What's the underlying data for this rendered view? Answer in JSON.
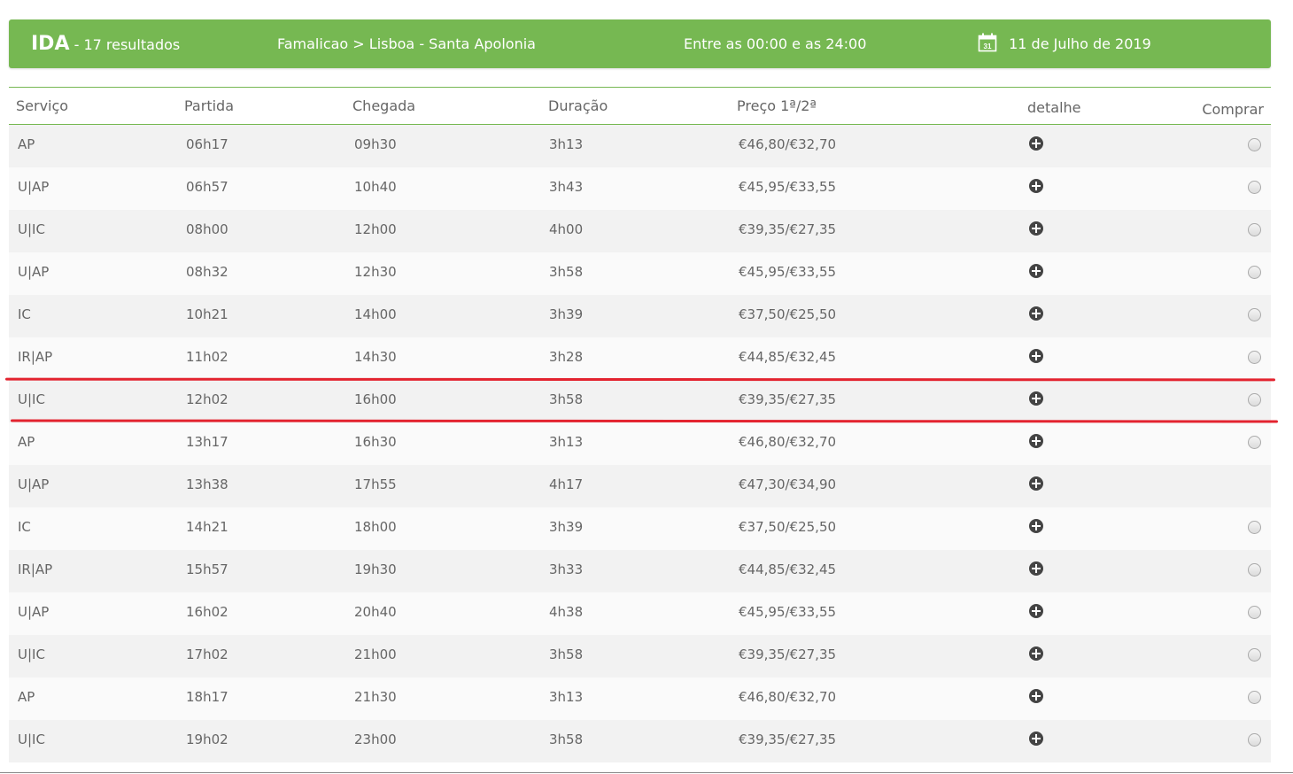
{
  "header": {
    "direction": "IDA",
    "results": "- 17 resultados",
    "route": "Famalicao > Lisboa - Santa Apolonia",
    "time_range": "Entre as 00:00 e as 24:00",
    "date": "11 de Julho de 2019",
    "calendar_day": "31",
    "accent_color": "#76b852"
  },
  "table": {
    "columns": [
      "Serviço",
      "Partida",
      "Chegada",
      "Duração",
      "Preço 1ª/2ª",
      "detalhe",
      "Comprar"
    ],
    "rows": [
      {
        "servico": "AP",
        "partida": "06h17",
        "chegada": "09h30",
        "duracao": "3h13",
        "preco": "€46,80/€32,70",
        "buy": true
      },
      {
        "servico": "U|AP",
        "partida": "06h57",
        "chegada": "10h40",
        "duracao": "3h43",
        "preco": "€45,95/€33,55",
        "buy": true
      },
      {
        "servico": "U|IC",
        "partida": "08h00",
        "chegada": "12h00",
        "duracao": "4h00",
        "preco": "€39,35/€27,35",
        "buy": true
      },
      {
        "servico": "U|AP",
        "partida": "08h32",
        "chegada": "12h30",
        "duracao": "3h58",
        "preco": "€45,95/€33,55",
        "buy": true
      },
      {
        "servico": "IC",
        "partida": "10h21",
        "chegada": "14h00",
        "duracao": "3h39",
        "preco": "€37,50/€25,50",
        "buy": true
      },
      {
        "servico": "IR|AP",
        "partida": "11h02",
        "chegada": "14h30",
        "duracao": "3h28",
        "preco": "€44,85/€32,45",
        "buy": true
      },
      {
        "servico": "U|IC",
        "partida": "12h02",
        "chegada": "16h00",
        "duracao": "3h58",
        "preco": "€39,35/€27,35",
        "buy": true
      },
      {
        "servico": "AP",
        "partida": "13h17",
        "chegada": "16h30",
        "duracao": "3h13",
        "preco": "€46,80/€32,70",
        "buy": true
      },
      {
        "servico": "U|AP",
        "partida": "13h38",
        "chegada": "17h55",
        "duracao": "4h17",
        "preco": "€47,30/€34,90",
        "buy": false
      },
      {
        "servico": "IC",
        "partida": "14h21",
        "chegada": "18h00",
        "duracao": "3h39",
        "preco": "€37,50/€25,50",
        "buy": true
      },
      {
        "servico": "IR|AP",
        "partida": "15h57",
        "chegada": "19h30",
        "duracao": "3h33",
        "preco": "€44,85/€32,45",
        "buy": true
      },
      {
        "servico": "U|AP",
        "partida": "16h02",
        "chegada": "20h40",
        "duracao": "4h38",
        "preco": "€45,95/€33,55",
        "buy": true
      },
      {
        "servico": "U|IC",
        "partida": "17h02",
        "chegada": "21h00",
        "duracao": "3h58",
        "preco": "€39,35/€27,35",
        "buy": true
      },
      {
        "servico": "AP",
        "partida": "18h17",
        "chegada": "21h30",
        "duracao": "3h13",
        "preco": "€46,80/€32,70",
        "buy": true
      },
      {
        "servico": "U|IC",
        "partida": "19h02",
        "chegada": "23h00",
        "duracao": "3h58",
        "preco": "€39,35/€27,35",
        "buy": true
      }
    ],
    "detail_icon": "plus-circle-icon",
    "highlight_color": "#e3232f"
  }
}
